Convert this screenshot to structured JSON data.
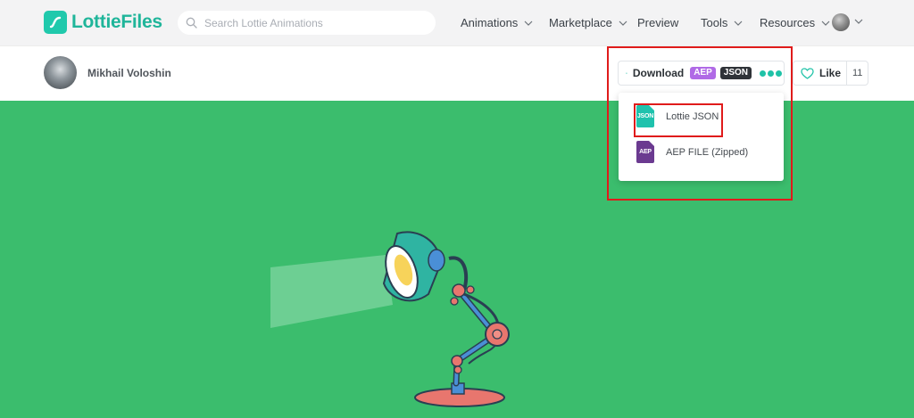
{
  "brand": {
    "name": "LottieFiles"
  },
  "search": {
    "placeholder": "Search Lottie Animations",
    "value": ""
  },
  "nav": {
    "items": [
      {
        "label": "Animations",
        "has_dropdown": true
      },
      {
        "label": "Marketplace",
        "has_dropdown": true
      },
      {
        "label": "Preview",
        "has_dropdown": false
      },
      {
        "label": "Tools",
        "has_dropdown": true
      },
      {
        "label": "Resources",
        "has_dropdown": true
      }
    ]
  },
  "author": {
    "name": "Mikhail Voloshin"
  },
  "download": {
    "label": "Download",
    "badges": [
      "AEP",
      "JSON"
    ],
    "icon": "download-icon",
    "more_icon": "more-dots-icon"
  },
  "like": {
    "label": "Like",
    "count": "11",
    "icon": "heart-icon"
  },
  "download_menu": {
    "items": [
      {
        "label": "Lottie JSON",
        "icon_text": "JSON",
        "icon": "json-file-icon"
      },
      {
        "label": "AEP FILE (Zipped)",
        "icon_text": "AEP",
        "icon": "aep-file-icon"
      }
    ]
  },
  "colors": {
    "brand": "#20c9ac",
    "stage_background": "#3bbd6d",
    "aep_badge": "#b06ae6",
    "json_badge": "#2f3338",
    "highlight": "#e01b1b"
  }
}
